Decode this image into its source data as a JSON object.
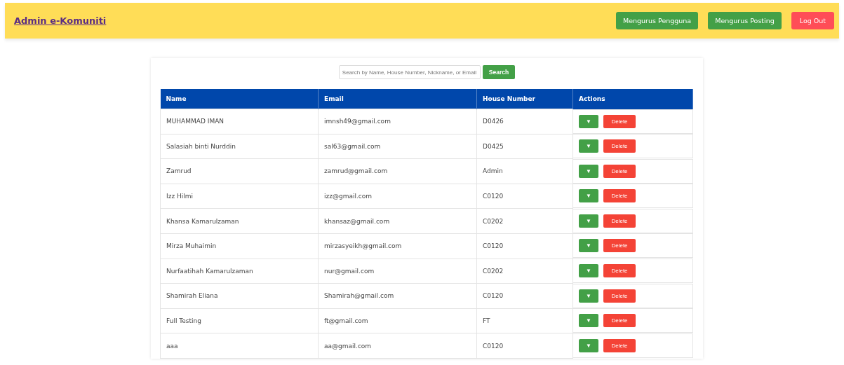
{
  "header": {
    "title": "Admin e-Komuniti",
    "buttons": [
      {
        "label": "Mengurus Pengguna",
        "kind": "nav"
      },
      {
        "label": "Mengurus Posting",
        "kind": "nav"
      },
      {
        "label": "Log Out",
        "kind": "logout"
      }
    ]
  },
  "search": {
    "placeholder": "Search by Name, House Number, Nickname, or Email",
    "button": "Search"
  },
  "table": {
    "columns": [
      "Name",
      "Email",
      "House Number",
      "Actions"
    ],
    "rows": [
      {
        "name": "MUHAMMAD IMAN",
        "email": "imnsh49@gmail.com",
        "house": "D0426",
        "expand": "▼",
        "delete": "Delete"
      },
      {
        "name": "Salasiah binti Nurddin",
        "email": "sal63@gmail.com",
        "house": "D0425",
        "expand": "▼",
        "delete": "Delete"
      },
      {
        "name": "Zamrud",
        "email": "zamrud@gmail.com",
        "house": "Admin",
        "expand": "▼",
        "delete": "Delete"
      },
      {
        "name": "Izz Hilmi",
        "email": "izz@gmail.com",
        "house": "C0120",
        "expand": "▼",
        "delete": "Delete"
      },
      {
        "name": "Khansa Kamarulzaman",
        "email": "khansaz@gmail.com",
        "house": "C0202",
        "expand": "▼",
        "delete": "Delete"
      },
      {
        "name": "Mirza Muhaimin",
        "email": "mirzasyeikh@gmail.com",
        "house": "C0120",
        "expand": "▼",
        "delete": "Delete"
      },
      {
        "name": "Nurfaatihah Kamarulzaman",
        "email": "nur@gmail.com",
        "house": "C0202",
        "expand": "▼",
        "delete": "Delete"
      },
      {
        "name": "Shamirah Eliana",
        "email": "Shamirah@gmail.com",
        "house": "C0120",
        "expand": "▼",
        "delete": "Delete"
      },
      {
        "name": "Full Testing",
        "email": "ft@gmail.com",
        "house": "FT",
        "expand": "▼",
        "delete": "Delete"
      },
      {
        "name": "aaa",
        "email": "aa@gmail.com",
        "house": "C0120",
        "expand": "▼",
        "delete": "Delete"
      }
    ]
  }
}
